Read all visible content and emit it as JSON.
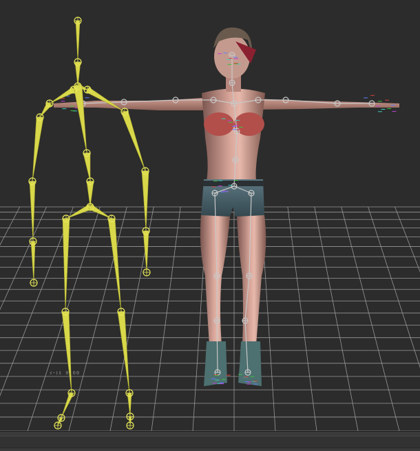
{
  "viewport": {
    "floor_label": "ﾒｰﾄﾙ 0.00",
    "background_color": "#2c2c2c",
    "grid_color": "#bdbdbd",
    "bone_color": "#d8d84a",
    "joint_icon": "crosshair-circle-icon"
  },
  "status_bar": {
    "background_color": "#3a3a3a"
  }
}
